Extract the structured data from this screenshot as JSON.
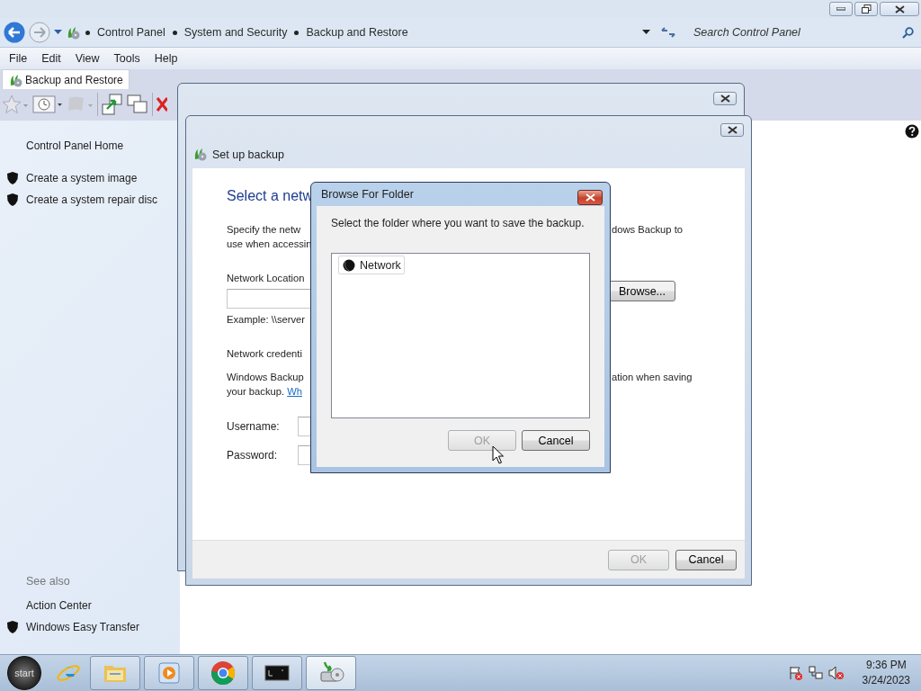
{
  "address_bar": {
    "breadcrumb": [
      "Control Panel",
      "System and Security",
      "Backup and Restore"
    ],
    "search": {
      "placeholder": "Search Control Panel"
    }
  },
  "menu_bar": [
    "File",
    "Edit",
    "View",
    "Tools",
    "Help"
  ],
  "tab": {
    "label": "Backup and Restore"
  },
  "sidebar": {
    "items": [
      {
        "label": "Control Panel Home",
        "shield": false
      },
      {
        "label": "Create a system image",
        "shield": true
      },
      {
        "label": "Create a system repair disc",
        "shield": true
      }
    ],
    "see_also": {
      "heading": "See also",
      "items": [
        {
          "label": "Action Center",
          "shield": false
        },
        {
          "label": "Windows Easy Transfer",
          "shield": true
        }
      ]
    }
  },
  "setup_dialog": {
    "title": "Set up backup",
    "heading": "Select a netw",
    "intro": {
      "line_1": "Specify the netw",
      "line_1_end": "dows Backup to",
      "line_2": "use when accessin"
    },
    "location": {
      "label": "Network Location",
      "example": "Example: \\\\server",
      "browse_button": "Browse..."
    },
    "credentials": {
      "heading": "Network credenti",
      "line_1": "Windows Backup",
      "line_1_end": "ation when saving",
      "line_2": "your backup.",
      "link": "Wh"
    },
    "username_label": "Username:",
    "password_label": "Password:",
    "buttons": [
      {
        "label": "OK",
        "disabled": true
      },
      {
        "label": "Cancel",
        "disabled": false
      }
    ]
  },
  "browse_dialog": {
    "title": "Browse For Folder",
    "instruction": "Select the folder where you want to save the backup.",
    "tree": [
      {
        "label": "Network",
        "selected": false
      }
    ],
    "buttons": [
      {
        "label": "OK",
        "disabled": true
      },
      {
        "label": "Cancel",
        "disabled": false
      }
    ]
  },
  "taskbar": {
    "start": "start",
    "items": [
      {
        "kind": "ie",
        "running": false,
        "active": false
      },
      {
        "kind": "folder",
        "running": true,
        "active": false
      },
      {
        "kind": "media",
        "running": true,
        "active": false
      },
      {
        "kind": "chrome",
        "running": true,
        "active": false
      },
      {
        "kind": "terminal",
        "running": true,
        "active": false
      },
      {
        "kind": "backup",
        "running": true,
        "active": true
      }
    ],
    "clock": {
      "time": "9:36 PM",
      "date": "3/24/2023"
    }
  }
}
